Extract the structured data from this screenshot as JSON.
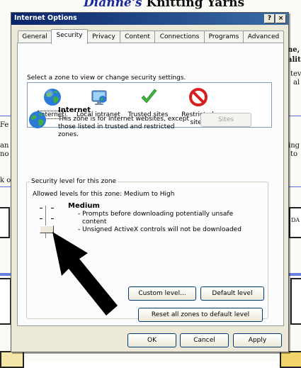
{
  "background_page": {
    "title_name": "Dianne's",
    "title_rest": "Knitting Yarns",
    "fragments": [
      "ne,",
      "ality",
      "tev",
      "al",
      "Fe",
      "an",
      "no",
      "k ou",
      "ing",
      "to",
      "DA"
    ]
  },
  "window": {
    "title": "Internet Options",
    "help_button": "?",
    "close_button": "×"
  },
  "tabs": [
    "General",
    "Security",
    "Privacy",
    "Content",
    "Connections",
    "Programs",
    "Advanced"
  ],
  "active_tab": "Security",
  "zone_selection_text": "Select a zone to view or change security settings.",
  "zones": [
    {
      "label": "Internet",
      "icon": "globe-icon",
      "selected": true
    },
    {
      "label": "Local intranet",
      "icon": "monitor-globe-icon",
      "selected": false
    },
    {
      "label": "Trusted sites",
      "icon": "checkmark-icon",
      "selected": false
    },
    {
      "label_line1": "Restricted",
      "label_line2": "sites",
      "icon": "no-entry-icon",
      "selected": false
    }
  ],
  "zone_info": {
    "title": "Internet",
    "description": "This zone is for Internet websites, except those listed in trusted and restricted zones.",
    "sites_button": "Sites",
    "sites_enabled": false
  },
  "security_level": {
    "group_label": "Security level for this zone",
    "allowed_text": "Allowed levels for this zone: Medium to High",
    "level_name": "Medium",
    "line1": "- Prompts before downloading potentially unsafe",
    "line1b": "content",
    "line2": "- Unsigned ActiveX controls will not be downloaded",
    "slider_level": "Medium",
    "custom_level_button": "Custom level...",
    "default_level_button": "Default level",
    "reset_all_button": "Reset all zones to default level"
  },
  "footer_buttons": {
    "ok": "OK",
    "cancel": "Cancel",
    "apply": "Apply"
  },
  "colors": {
    "titlebar": "#0a246a",
    "dialog_bg": "#ece9d8",
    "arrow": "#000000"
  }
}
